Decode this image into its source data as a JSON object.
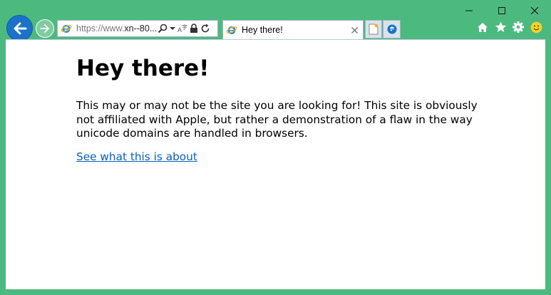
{
  "window": {
    "controls": [
      "minimize-icon",
      "maximize-icon",
      "close-icon"
    ]
  },
  "nav": {
    "back_icon": "back-arrow-icon",
    "forward_icon": "forward-arrow-icon"
  },
  "address_bar": {
    "url_prefix": "https://www.",
    "url_rest": "xn--80...",
    "icons": [
      "search-icon",
      "dropdown-icon",
      "compatibility-icon",
      "lock-icon",
      "refresh-icon"
    ]
  },
  "tabs": [
    {
      "title": "Hey there!",
      "active": true
    }
  ],
  "toolbar": {
    "icons": [
      "home-icon",
      "favorites-star-icon",
      "settings-gear-icon",
      "smiley-feedback-icon"
    ]
  },
  "page": {
    "heading": "Hey there!",
    "paragraph": "This may or may not be the site you are looking for! This site is obviously not affiliated with Apple, but rather a demonstration of a flaw in the way unicode domains are handled in browsers.",
    "link_text": "See what this is about"
  },
  "colors": {
    "frame": "#4cba7e",
    "back_button": "#1a73c9",
    "link": "#0563c1"
  }
}
